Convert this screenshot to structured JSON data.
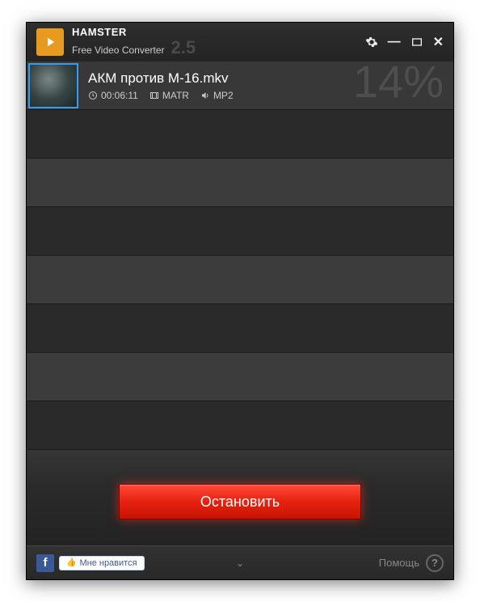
{
  "app": {
    "name": "HAMSTER",
    "subtitle": "Free Video Converter",
    "version": "2.5"
  },
  "file": {
    "name": "АКМ против М-16.mkv",
    "duration": "00:06:11",
    "video_codec": "MATR",
    "audio_codec": "MP2",
    "progress": "14%"
  },
  "action": {
    "stop_label": "Остановить"
  },
  "footer": {
    "fb_letter": "f",
    "like_label": "Мне нравится",
    "help_label": "Помощь",
    "help_q": "?"
  }
}
